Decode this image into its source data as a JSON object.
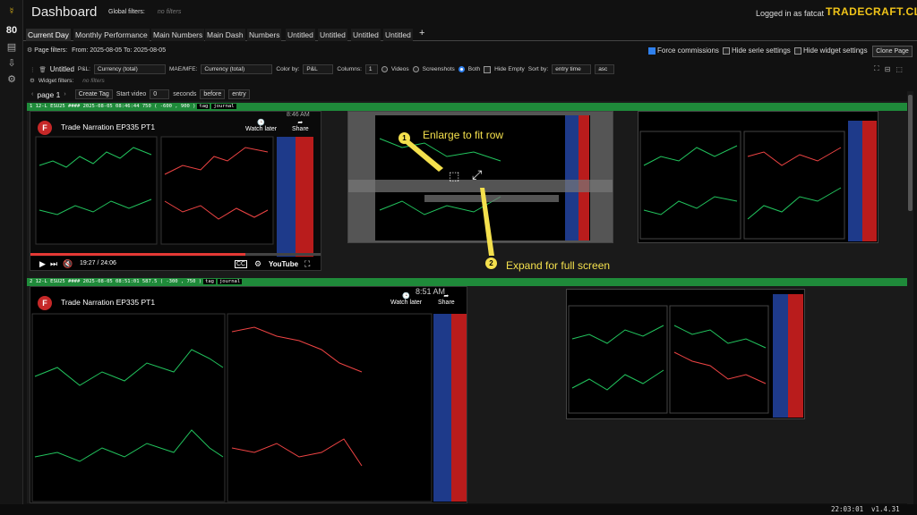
{
  "app": {
    "title": "Dashboard",
    "global_filters_label": "Global filters:",
    "global_filters_value": "no filters",
    "logged_in": "Logged in as fatcat",
    "brand": "TRADECRAFT.CLUB"
  },
  "tabs": [
    {
      "label": "Current Day"
    },
    {
      "label": "Monthly Performance"
    },
    {
      "label": "Main Numbers"
    },
    {
      "label": "Main Dash"
    },
    {
      "label": "Numbers"
    },
    {
      "label": "Untitled"
    },
    {
      "label": "Untitled"
    },
    {
      "label": "Untitled"
    },
    {
      "label": "Untitled"
    }
  ],
  "add_tab": "+",
  "page_filters": {
    "label": "Page filters:",
    "value": "From: 2025-08-05 To: 2025-08-05"
  },
  "options": {
    "force_commissions": "Force commissions",
    "hide_serie": "Hide serie settings",
    "hide_widget": "Hide widget settings",
    "clone": "Clone Page"
  },
  "widget": {
    "name": "Untitled",
    "pl_label": "P&L:",
    "pl_value": "Currency (total)",
    "mae_label": "MAE/MFE:",
    "mae_value": "Currency (total)",
    "color_label": "Color by:",
    "color_value": "P&L",
    "columns_label": "Columns:",
    "columns_value": "1",
    "videos": "Videos",
    "screenshots": "Screenshots",
    "both": "Both",
    "hide_empty": "Hide Empty",
    "sort_label": "Sort by:",
    "sort_value": "entry time",
    "order": "asc"
  },
  "widget_filters": {
    "label": "Widget filters:",
    "value": "no filters"
  },
  "controls": {
    "page": "page 1",
    "create_tag": "Create Tag",
    "start_video": "Start video",
    "start_value": "0",
    "seconds": "seconds",
    "before": "before",
    "entry": "entry"
  },
  "rows": [
    {
      "num": "1",
      "bar": "12-L ESU25 #### 2025-08-05 08:46:44 750 ( -600 , 900 )",
      "tag": "tag",
      "journal": "journal"
    },
    {
      "num": "2",
      "bar": "12-L ESU25 #### 2025-08-05 08:51:01 587.5 ( -300 , 750 )",
      "tag": "tag",
      "journal": "journal"
    }
  ],
  "video": {
    "title": "Trade Narration EP335 PT1",
    "watch_later": "Watch later",
    "share": "Share",
    "time": "19:27 / 24:06",
    "youtube": "YouTube",
    "clock1": "8:46 AM",
    "clock2": "8:51 AM"
  },
  "annotations": {
    "a1": "Enlarge to fit row",
    "a2": "Expand for full screen",
    "n1": "1",
    "n2": "2"
  },
  "status": {
    "time": "22:03:01",
    "version": "v1.4.31"
  },
  "colors": {
    "accent": "#2f80ed",
    "brand": "#f0c419",
    "row_bar": "#1f8a3a",
    "annotation": "#f4e04d"
  }
}
